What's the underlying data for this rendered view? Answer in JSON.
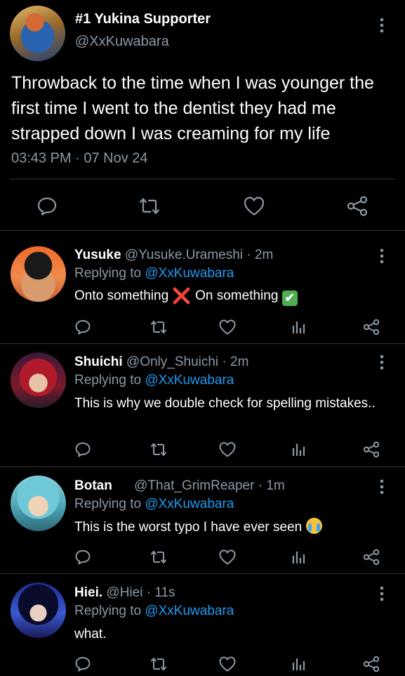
{
  "tweet": {
    "display_name": "#1 Yukina Supporter",
    "handle": "@XxKuwabara",
    "text": "Throwback to the time when I was younger the first time I went to the dentist they had me strapped down I was creaming for my life",
    "timestamp": "03:43 PM · 07 Nov 24",
    "actions": [
      "reply-icon",
      "retweet-icon",
      "heart-icon",
      "share-icon"
    ]
  },
  "replies": [
    {
      "name": "Yusuke",
      "handle": "@Yusuke.Urameshi",
      "time": "· 2m",
      "replying_prefix": "Replying to",
      "replying_to": "@XxKuwabara",
      "text_before": "Onto something",
      "text_after": "On something",
      "emoji_1": "❌",
      "emoji_2": "✔"
    },
    {
      "name": "Shuichi",
      "handle": "@Only_Shuichi",
      "time": "· 2m",
      "replying_prefix": "Replying to",
      "replying_to": "@XxKuwabara",
      "text": "This is why we double check for spelling mistakes.."
    },
    {
      "name": "Botan",
      "handle": "@That_GrimReaper",
      "time": "· 1m",
      "replying_prefix": "Replying to",
      "replying_to": "@XxKuwabara",
      "text": "This is the worst typo I have ever seen",
      "emoji": "crying-face"
    },
    {
      "name": "Hiei.",
      "handle": "@Hiei",
      "time": "· 11s",
      "replying_prefix": "Replying to",
      "replying_to": "@XxKuwabara",
      "text": "what."
    }
  ],
  "reply_actions": [
    "reply-icon",
    "retweet-icon",
    "heart-icon",
    "views-icon",
    "share-icon"
  ],
  "colors": {
    "background": "#000000",
    "text": "#e7e9ea",
    "muted": "#8b98a5",
    "link": "#1d9bf0",
    "divider": "#2f3336"
  }
}
